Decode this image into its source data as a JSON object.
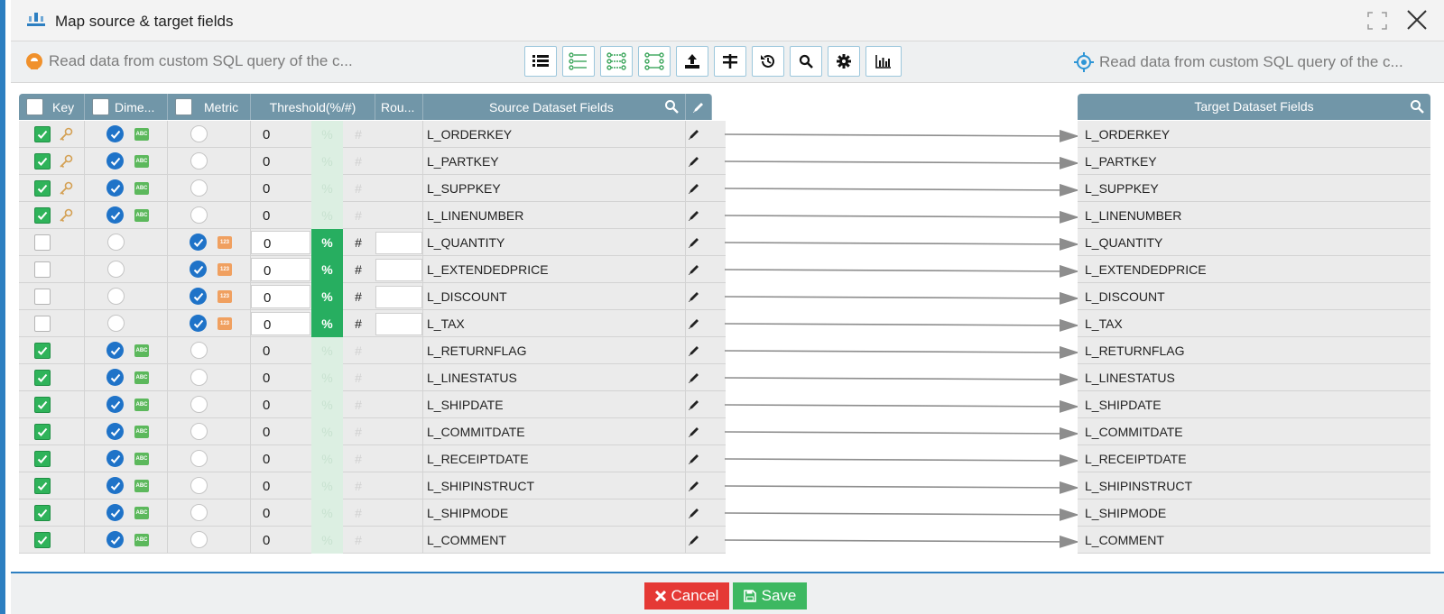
{
  "window": {
    "title": "Map source & target fields"
  },
  "toolbar": {
    "source_label": "Read data from custom SQL query of the c...",
    "target_label": "Read data from custom SQL query of the c...",
    "buttons": [
      "list-view-icon",
      "map-all-icon",
      "map-by-name-icon",
      "map-by-position-icon",
      "upload-icon",
      "split-icon",
      "history-icon",
      "search-icon",
      "settings-icon",
      "chart-icon"
    ]
  },
  "columns": {
    "key": "Key",
    "dimension": "Dime...",
    "metric": "Metric",
    "threshold": "Threshold(%/#)",
    "rounding": "Rou...",
    "source": "Source Dataset Fields",
    "target": "Target Dataset Fields"
  },
  "rows": [
    {
      "source": "L_ORDERKEY",
      "target": "L_ORDERKEY",
      "key": true,
      "is_key_field": true,
      "type": "dimension",
      "threshold": "0"
    },
    {
      "source": "L_PARTKEY",
      "target": "L_PARTKEY",
      "key": true,
      "is_key_field": true,
      "type": "dimension",
      "threshold": "0"
    },
    {
      "source": "L_SUPPKEY",
      "target": "L_SUPPKEY",
      "key": true,
      "is_key_field": true,
      "type": "dimension",
      "threshold": "0"
    },
    {
      "source": "L_LINENUMBER",
      "target": "L_LINENUMBER",
      "key": true,
      "is_key_field": true,
      "type": "dimension",
      "threshold": "0"
    },
    {
      "source": "L_QUANTITY",
      "target": "L_QUANTITY",
      "key": false,
      "is_key_field": false,
      "type": "metric",
      "threshold": "0"
    },
    {
      "source": "L_EXTENDEDPRICE",
      "target": "L_EXTENDEDPRICE",
      "key": false,
      "is_key_field": false,
      "type": "metric",
      "threshold": "0"
    },
    {
      "source": "L_DISCOUNT",
      "target": "L_DISCOUNT",
      "key": false,
      "is_key_field": false,
      "type": "metric",
      "threshold": "0"
    },
    {
      "source": "L_TAX",
      "target": "L_TAX",
      "key": false,
      "is_key_field": false,
      "type": "metric",
      "threshold": "0"
    },
    {
      "source": "L_RETURNFLAG",
      "target": "L_RETURNFLAG",
      "key": true,
      "is_key_field": false,
      "type": "dimension",
      "threshold": "0"
    },
    {
      "source": "L_LINESTATUS",
      "target": "L_LINESTATUS",
      "key": true,
      "is_key_field": false,
      "type": "dimension",
      "threshold": "0"
    },
    {
      "source": "L_SHIPDATE",
      "target": "L_SHIPDATE",
      "key": true,
      "is_key_field": false,
      "type": "dimension",
      "threshold": "0"
    },
    {
      "source": "L_COMMITDATE",
      "target": "L_COMMITDATE",
      "key": true,
      "is_key_field": false,
      "type": "dimension",
      "threshold": "0"
    },
    {
      "source": "L_RECEIPTDATE",
      "target": "L_RECEIPTDATE",
      "key": true,
      "is_key_field": false,
      "type": "dimension",
      "threshold": "0"
    },
    {
      "source": "L_SHIPINSTRUCT",
      "target": "L_SHIPINSTRUCT",
      "key": true,
      "is_key_field": false,
      "type": "dimension",
      "threshold": "0"
    },
    {
      "source": "L_SHIPMODE",
      "target": "L_SHIPMODE",
      "key": true,
      "is_key_field": false,
      "type": "dimension",
      "threshold": "0"
    },
    {
      "source": "L_COMMENT",
      "target": "L_COMMENT",
      "key": true,
      "is_key_field": false,
      "type": "dimension",
      "threshold": "0"
    }
  ],
  "symbols": {
    "percent": "%",
    "hash": "#",
    "abc": "ABC",
    "num": "123"
  },
  "footer": {
    "cancel_label": "Cancel",
    "save_label": "Save"
  },
  "colors": {
    "accent": "#2d7fc1",
    "header": "#7196a8",
    "check_green": "#2fb35a",
    "radio_blue": "#1f73c8",
    "cancel_red": "#e53935",
    "save_green": "#3db861"
  }
}
